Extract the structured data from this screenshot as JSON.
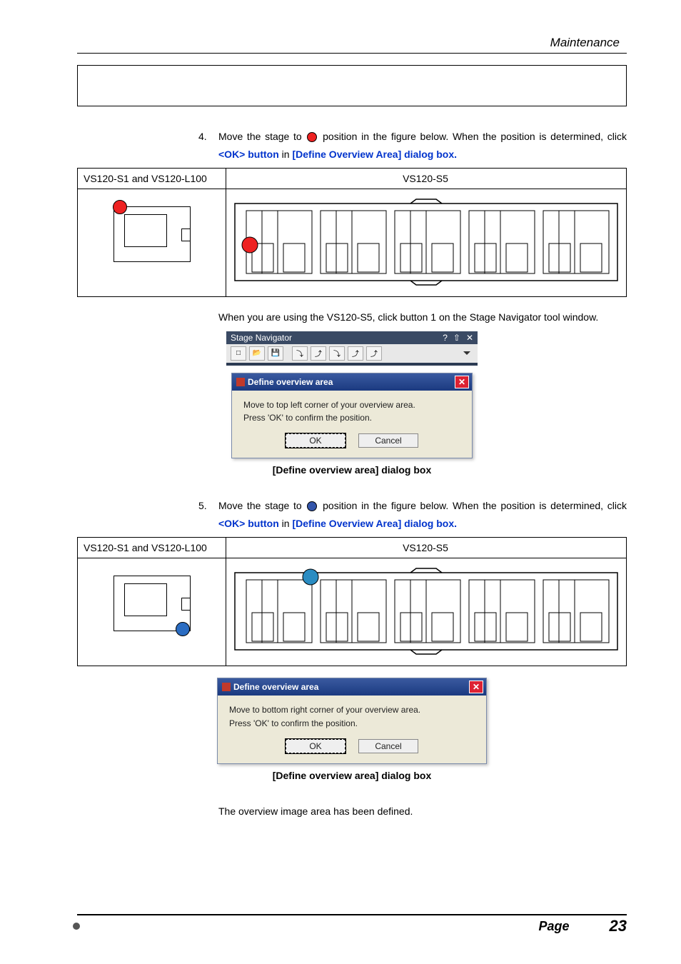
{
  "header": {
    "section": "Maintenance"
  },
  "steps": {
    "s4": {
      "num": "4.",
      "pre": "Move the stage to ",
      "post": " position in the figure below. When the position is determined, click ",
      "ok": "<OK> button",
      "in": " in ",
      "box": "[Define Overview Area] dialog box.",
      "note": "When you are using the VS120-S5, click button 1 on the Stage Navigator tool window."
    },
    "s5": {
      "num": "5.",
      "pre": "Move the stage to ",
      "post": " position in the figure below. When the position is determined, click ",
      "ok": "<OK> button",
      "in": " in ",
      "box": "[Define Overview Area] dialog box."
    }
  },
  "table": {
    "left": "VS120-S1 and VS120-L100",
    "right": "VS120-S5"
  },
  "stage_nav": {
    "title": "Stage Navigator",
    "icons": {
      "help": "?",
      "pin": "⇧",
      "close": "✕"
    },
    "toolbar": [
      "□",
      "📂",
      "💾",
      "⤵",
      "⤴",
      "⤵",
      "⤴",
      "⤴"
    ]
  },
  "dialog1": {
    "title": "Define overview area",
    "line1": "Move to top left corner of your overview area.",
    "line2": "Press 'OK' to confirm the position.",
    "ok": "OK",
    "cancel": "Cancel"
  },
  "dialog2": {
    "title": "Define overview area",
    "line1": "Move to bottom right corner of your overview area.",
    "line2": "Press 'OK' to confirm the position.",
    "ok": "OK",
    "cancel": "Cancel"
  },
  "captions": {
    "c1": "[Define overview area] dialog box",
    "c2": "[Define overview area] dialog box"
  },
  "conclusion": "The overview image area has been defined.",
  "footer": {
    "label": "Page",
    "num": "23"
  }
}
